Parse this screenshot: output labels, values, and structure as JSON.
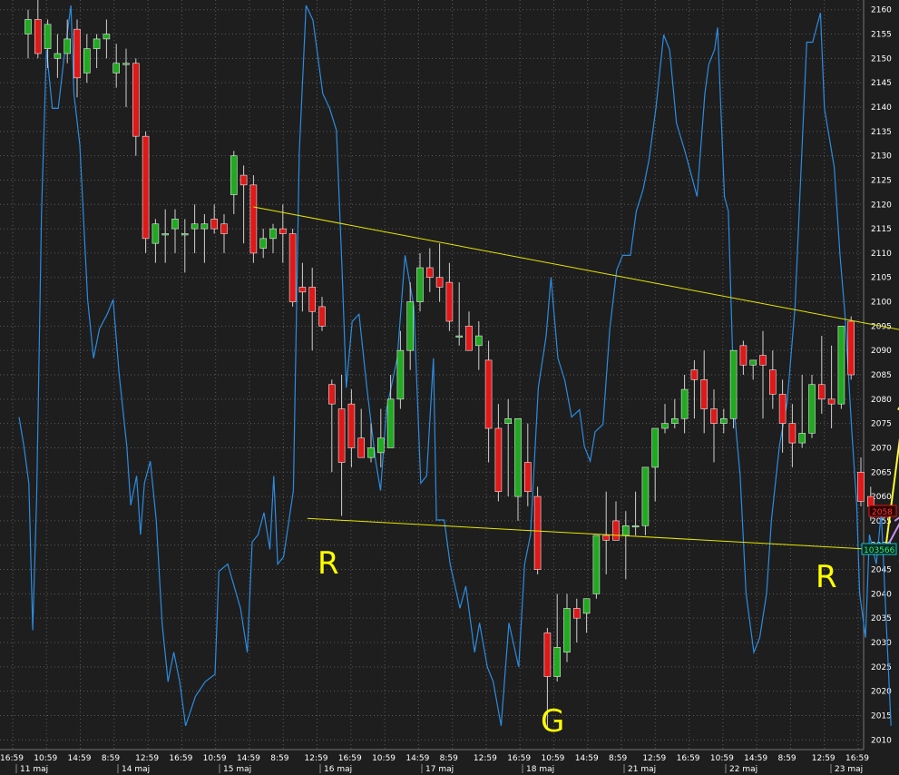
{
  "chart_data": {
    "type": "candlestick",
    "title": "",
    "ylim": [
      2008,
      2162
    ],
    "y_ticks": [
      2010,
      2015,
      2020,
      2025,
      2030,
      2035,
      2040,
      2045,
      2050,
      2055,
      2060,
      2065,
      2070,
      2075,
      2080,
      2085,
      2090,
      2095,
      2100,
      2105,
      2110,
      2115,
      2120,
      2125,
      2130,
      2135,
      2140,
      2145,
      2150,
      2155,
      2160
    ],
    "x_time_labels": [
      "16:59",
      "10:59",
      "14:59",
      "8:59",
      "12:59",
      "16:59",
      "10:59",
      "14:59",
      "8:59",
      "12:59",
      "16:59",
      "10:59",
      "14:59",
      "8:59",
      "12:59",
      "16:59",
      "10:59",
      "14:59",
      "8:59",
      "12:59",
      "16:59",
      "10:59",
      "14:59",
      "8:59",
      "12:59",
      "16:59"
    ],
    "x_date_labels": [
      "11 maj",
      "14 maj",
      "15 maj",
      "16 maj",
      "17 maj",
      "18 maj",
      "21 maj",
      "22 maj",
      "23 maj"
    ],
    "up_color": "#1faa1f",
    "down_color": "#e01818",
    "line_color": "#2c8ce0",
    "trendline_color": "#e6e600",
    "price_badge": "2058",
    "secondary_badge": "103566",
    "annotations": [
      {
        "text": "R"
      },
      {
        "text": "G"
      },
      {
        "text": "R"
      }
    ],
    "candles": [
      [
        2155,
        2160,
        2150,
        2158
      ],
      [
        2158,
        2162,
        2150,
        2151
      ],
      [
        2152,
        2158,
        2148,
        2157
      ],
      [
        2150,
        2155,
        2146,
        2151
      ],
      [
        2151,
        2158,
        2149,
        2154
      ],
      [
        2156,
        2158,
        2142,
        2146
      ],
      [
        2147,
        2155,
        2145,
        2152
      ],
      [
        2152,
        2155,
        2148,
        2154
      ],
      [
        2154,
        2158,
        2150,
        2155
      ],
      [
        2147,
        2153,
        2144,
        2149
      ],
      [
        2149,
        2152,
        2140,
        2149
      ],
      [
        2149,
        2150,
        2130,
        2134
      ],
      [
        2134,
        2135,
        2110,
        2113
      ],
      [
        2112,
        2117,
        2108,
        2116
      ],
      [
        2114,
        2119,
        2108,
        2114
      ],
      [
        2115,
        2119,
        2110,
        2117
      ],
      [
        2114,
        2117,
        2106,
        2114
      ],
      [
        2115,
        2120,
        2110,
        2116
      ],
      [
        2115,
        2118,
        2108,
        2116
      ],
      [
        2117,
        2120,
        2114,
        2115
      ],
      [
        2116,
        2118,
        2110,
        2114
      ],
      [
        2122,
        2131,
        2118,
        2130
      ],
      [
        2126,
        2128,
        2112,
        2124
      ],
      [
        2124,
        2126,
        2108,
        2110
      ],
      [
        2111,
        2115,
        2109,
        2113
      ],
      [
        2113,
        2116,
        2110,
        2115
      ],
      [
        2115,
        2120,
        2108,
        2114
      ],
      [
        2114,
        2115,
        2099,
        2100
      ],
      [
        2103,
        2108,
        2098,
        2102
      ],
      [
        2103,
        2107,
        2090,
        2098
      ],
      [
        2099,
        2101,
        2094,
        2095
      ],
      [
        2083,
        2084,
        2065,
        2079
      ],
      [
        2078,
        2085,
        2056,
        2067
      ],
      [
        2079,
        2082,
        2066,
        2070
      ],
      [
        2072,
        2078,
        2068,
        2068
      ],
      [
        2068,
        2075,
        2067,
        2070
      ],
      [
        2069,
        2078,
        2066,
        2072
      ],
      [
        2070,
        2085,
        2070,
        2080
      ],
      [
        2080,
        2094,
        2078,
        2090
      ],
      [
        2090,
        2104,
        2086,
        2100
      ],
      [
        2100,
        2110,
        2098,
        2107
      ],
      [
        2107,
        2111,
        2102,
        2105
      ],
      [
        2105,
        2112,
        2100,
        2103
      ],
      [
        2104,
        2108,
        2094,
        2096
      ],
      [
        2093,
        2104,
        2091,
        2093
      ],
      [
        2095,
        2098,
        2090,
        2090
      ],
      [
        2091,
        2096,
        2086,
        2093
      ],
      [
        2088,
        2092,
        2067,
        2074
      ],
      [
        2074,
        2079,
        2059,
        2061
      ],
      [
        2075,
        2080,
        2060,
        2076
      ],
      [
        2060,
        2063,
        2055,
        2076
      ],
      [
        2067,
        2075,
        2058,
        2061
      ],
      [
        2060,
        2062,
        2044,
        2045
      ],
      [
        2032,
        2033,
        2012,
        2023
      ],
      [
        2023,
        2040,
        2022,
        2029
      ],
      [
        2028,
        2040,
        2026,
        2037
      ],
      [
        2037,
        2039,
        2030,
        2035
      ],
      [
        2036,
        2039,
        2032,
        2039
      ],
      [
        2040,
        2050,
        2039,
        2052
      ],
      [
        2052,
        2061,
        2044,
        2051
      ],
      [
        2055,
        2059,
        2051,
        2051
      ],
      [
        2052,
        2057,
        2043,
        2054
      ],
      [
        2054,
        2061,
        2052,
        2054
      ],
      [
        2054,
        2066,
        2052,
        2066
      ],
      [
        2066,
        2070,
        2059,
        2074
      ],
      [
        2074,
        2079,
        2073,
        2075
      ],
      [
        2075,
        2080,
        2074,
        2076
      ],
      [
        2076,
        2085,
        2073,
        2082
      ],
      [
        2086,
        2088,
        2076,
        2084
      ],
      [
        2084,
        2090,
        2073,
        2078
      ],
      [
        2078,
        2082,
        2067,
        2075
      ],
      [
        2075,
        2078,
        2073,
        2076
      ],
      [
        2076,
        2088,
        2074,
        2090
      ],
      [
        2091,
        2092,
        2085,
        2087
      ],
      [
        2087,
        2088,
        2084,
        2088
      ],
      [
        2089,
        2094,
        2076,
        2087
      ],
      [
        2086,
        2090,
        2078,
        2081
      ],
      [
        2081,
        2084,
        2069,
        2075
      ],
      [
        2075,
        2079,
        2066,
        2071
      ],
      [
        2071,
        2085,
        2070,
        2073
      ],
      [
        2073,
        2085,
        2072,
        2083
      ],
      [
        2083,
        2093,
        2077,
        2080
      ],
      [
        2080,
        2091,
        2074,
        2079
      ],
      [
        2079,
        2095,
        2078,
        2095
      ],
      [
        2096,
        2097,
        2084,
        2085
      ],
      [
        2065,
        2068,
        2058,
        2059
      ],
      [
        2060,
        2062,
        2055,
        2058
      ]
    ],
    "line_series": [
      [
        0,
        0.44
      ],
      [
        0.5,
        0.4
      ],
      [
        1,
        0.35
      ],
      [
        1.4,
        0.15
      ],
      [
        1.8,
        0.33
      ],
      [
        2.3,
        0.72
      ],
      [
        2.8,
        0.94
      ],
      [
        3.4,
        0.86
      ],
      [
        4,
        0.86
      ],
      [
        4.6,
        0.93
      ],
      [
        5.3,
        1.0
      ],
      [
        5.6,
        0.88
      ],
      [
        6.2,
        0.81
      ],
      [
        7,
        0.6
      ],
      [
        7.6,
        0.52
      ],
      [
        8.2,
        0.56
      ],
      [
        9,
        0.58
      ],
      [
        9.6,
        0.6
      ],
      [
        10.2,
        0.5
      ],
      [
        11,
        0.4
      ],
      [
        11.4,
        0.32
      ],
      [
        12,
        0.36
      ],
      [
        12.4,
        0.28
      ],
      [
        12.8,
        0.35
      ],
      [
        13.4,
        0.38
      ],
      [
        14,
        0.3
      ],
      [
        14.6,
        0.16
      ],
      [
        15.2,
        0.08
      ],
      [
        15.8,
        0.12
      ],
      [
        16.4,
        0.08
      ],
      [
        17,
        0.02
      ],
      [
        18,
        0.06
      ],
      [
        19,
        0.08
      ],
      [
        20,
        0.09
      ],
      [
        20.4,
        0.23
      ],
      [
        21.3,
        0.24
      ],
      [
        22.6,
        0.18
      ],
      [
        23.3,
        0.12
      ],
      [
        23.8,
        0.27
      ],
      [
        24.4,
        0.28
      ],
      [
        25,
        0.31
      ],
      [
        25.6,
        0.26
      ],
      [
        26,
        0.36
      ],
      [
        26.4,
        0.24
      ],
      [
        27,
        0.25
      ],
      [
        28,
        0.34
      ],
      [
        28.6,
        0.8
      ],
      [
        29.3,
        1.0
      ],
      [
        30,
        0.98
      ],
      [
        30.6,
        0.92
      ],
      [
        31,
        0.88
      ],
      [
        31.7,
        0.86
      ],
      [
        32.4,
        0.83
      ],
      [
        33,
        0.63
      ],
      [
        33.4,
        0.48
      ],
      [
        34,
        0.57
      ],
      [
        34.7,
        0.58
      ],
      [
        35.5,
        0.48
      ],
      [
        36.4,
        0.38
      ],
      [
        36.9,
        0.34
      ],
      [
        37.5,
        0.45
      ],
      [
        38.6,
        0.52
      ],
      [
        39.4,
        0.66
      ],
      [
        40.3,
        0.59
      ],
      [
        41,
        0.35
      ],
      [
        41.6,
        0.36
      ],
      [
        42.3,
        0.52
      ],
      [
        42.6,
        0.3
      ],
      [
        43.4,
        0.3
      ],
      [
        44,
        0.24
      ],
      [
        45,
        0.18
      ],
      [
        45.6,
        0.21
      ],
      [
        46.5,
        0.12
      ],
      [
        47,
        0.16
      ],
      [
        47.8,
        0.1
      ],
      [
        48.4,
        0.08
      ],
      [
        49.2,
        0.02
      ],
      [
        50,
        0.16
      ],
      [
        51,
        0.1
      ],
      [
        51.6,
        0.24
      ],
      [
        52.2,
        0.28
      ],
      [
        53,
        0.48
      ],
      [
        53.8,
        0.55
      ],
      [
        54.3,
        0.63
      ],
      [
        55,
        0.52
      ],
      [
        55.7,
        0.49
      ],
      [
        56.4,
        0.44
      ],
      [
        57.2,
        0.45
      ],
      [
        57.7,
        0.4
      ],
      [
        58.3,
        0.38
      ],
      [
        58.8,
        0.42
      ],
      [
        59.6,
        0.43
      ],
      [
        60.3,
        0.56
      ],
      [
        61,
        0.64
      ],
      [
        61.6,
        0.66
      ],
      [
        62.4,
        0.66
      ],
      [
        63,
        0.72
      ],
      [
        63.7,
        0.75
      ],
      [
        64.3,
        0.79
      ],
      [
        65,
        0.86
      ],
      [
        65.8,
        0.96
      ],
      [
        66.4,
        0.94
      ],
      [
        67.1,
        0.84
      ],
      [
        68,
        0.8
      ],
      [
        68.6,
        0.77
      ],
      [
        69.2,
        0.74
      ],
      [
        70,
        0.88
      ],
      [
        70.4,
        0.92
      ],
      [
        71,
        0.94
      ],
      [
        71.3,
        0.97
      ],
      [
        72,
        0.74
      ],
      [
        72.4,
        0.72
      ],
      [
        73,
        0.45
      ],
      [
        73.6,
        0.36
      ],
      [
        74.2,
        0.2
      ],
      [
        75,
        0.12
      ],
      [
        75.6,
        0.14
      ],
      [
        76.3,
        0.2
      ],
      [
        76.8,
        0.3
      ],
      [
        77.6,
        0.4
      ],
      [
        78.4,
        0.46
      ],
      [
        79.2,
        0.59
      ],
      [
        79.8,
        0.77
      ],
      [
        80.4,
        0.95
      ],
      [
        81,
        0.95
      ],
      [
        81.8,
        0.99
      ],
      [
        82.2,
        0.86
      ],
      [
        83.2,
        0.78
      ],
      [
        83.8,
        0.66
      ],
      [
        84.3,
        0.58
      ],
      [
        85,
        0.42
      ],
      [
        85.5,
        0.32
      ],
      [
        85.8,
        0.2
      ],
      [
        86.4,
        0.14
      ],
      [
        86.8,
        0.28
      ],
      [
        87.5,
        0.24
      ],
      [
        88,
        0.31
      ],
      [
        89,
        0.02
      ]
    ],
    "trendlines": [
      {
        "from": [
          23,
          2119.5
        ],
        "to": [
          91,
          2093.5
        ]
      },
      {
        "from": [
          28.5,
          2055.5
        ],
        "to": [
          87.5,
          2049
        ]
      }
    ],
    "arrows": [
      {
        "color": "#ffff33",
        "from": [
          87.5,
          2049
        ],
        "to": [
          89.5,
          2080
        ]
      },
      {
        "color": "#c890f0",
        "from": [
          87.5,
          2049
        ],
        "to": [
          89.5,
          2056.5
        ]
      },
      {
        "color": "#c890f0",
        "from": [
          89.5,
          2049
        ],
        "to": [
          89.5,
          2014
        ]
      }
    ]
  }
}
